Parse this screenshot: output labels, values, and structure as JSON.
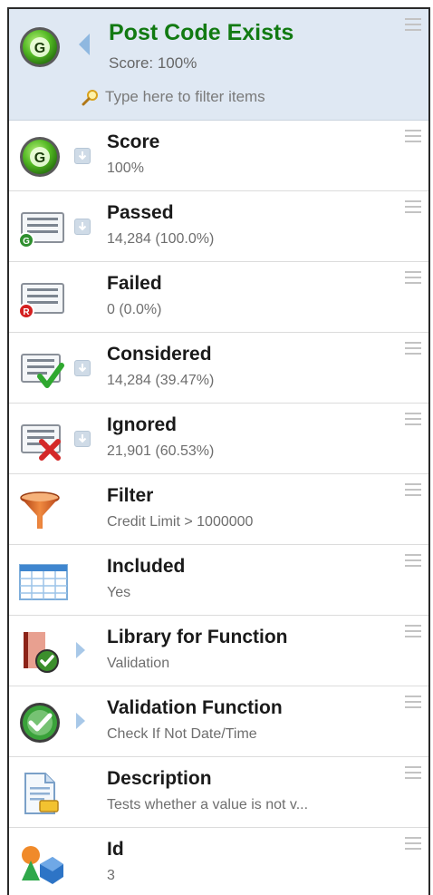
{
  "header": {
    "title": "Post Code Exists",
    "subtitle": "Score: 100%",
    "filter_placeholder": "Type here to filter items",
    "badge_letter": "G"
  },
  "rows": [
    {
      "title": "Score",
      "value": "100%",
      "icon": "score-g-icon",
      "badge": "G"
    },
    {
      "title": "Passed",
      "value": "14,284 (100.0%)",
      "icon": "passed-list-icon",
      "badge": "G"
    },
    {
      "title": "Failed",
      "value": "0 (0.0%)",
      "icon": "failed-list-icon",
      "badge": "R"
    },
    {
      "title": "Considered",
      "value": "14,284 (39.47%)",
      "icon": "considered-check-icon"
    },
    {
      "title": "Ignored",
      "value": "21,901 (60.53%)",
      "icon": "ignored-x-icon"
    },
    {
      "title": "Filter",
      "value": "Credit Limit > 1000000",
      "icon": "funnel-icon"
    },
    {
      "title": "Included",
      "value": "Yes",
      "icon": "table-grid-icon"
    },
    {
      "title": "Library for Function",
      "value": "Validation",
      "icon": "library-book-icon"
    },
    {
      "title": "Validation Function",
      "value": "Check If Not Date/Time",
      "icon": "validation-check-icon"
    },
    {
      "title": "Description",
      "value": "Tests whether a value is not v...",
      "icon": "document-icon"
    },
    {
      "title": "Id",
      "value": "3",
      "icon": "shapes-icon"
    }
  ],
  "colors": {
    "header_bg": "#dfe8f3",
    "title_green": "#127a12",
    "badge_green": "#3aa23a",
    "badge_red": "#d42020"
  }
}
